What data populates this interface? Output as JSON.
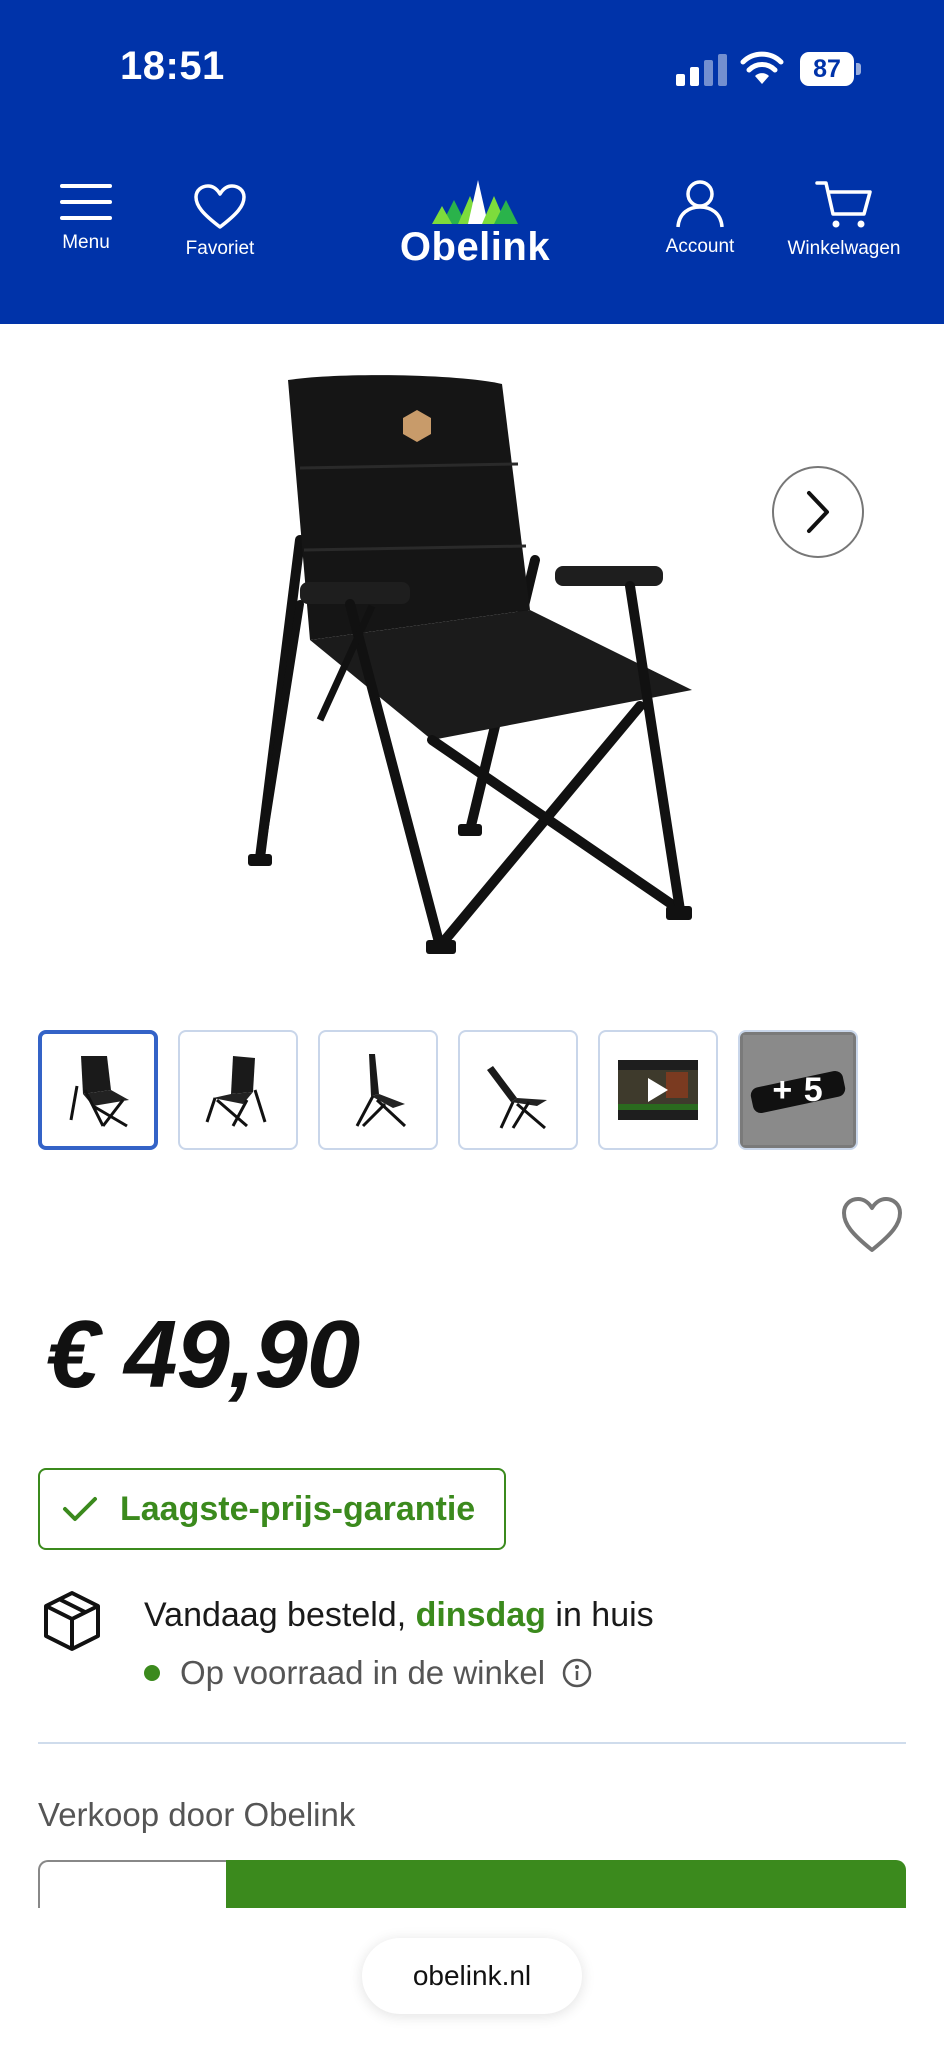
{
  "status_bar": {
    "time": "18:51",
    "battery": "87"
  },
  "nav": {
    "menu_label": "Menu",
    "favorite_label": "Favoriet",
    "logo_text": "Obelink",
    "account_label": "Account",
    "cart_label": "Winkelwagen"
  },
  "colors": {
    "brand_blue": "#0033a9",
    "accent_green": "#3b8a1d",
    "thumb_active": "#3463c7"
  },
  "gallery": {
    "thumbnails": [
      {
        "kind": "image",
        "active": true
      },
      {
        "kind": "image",
        "active": false
      },
      {
        "kind": "image",
        "active": false
      },
      {
        "kind": "image",
        "active": false
      },
      {
        "kind": "video",
        "active": false
      },
      {
        "kind": "more",
        "label": "+ 5"
      }
    ]
  },
  "product": {
    "price": "€ 49,90",
    "guarantee_label": "Laagste-prijs-garantie",
    "delivery_prefix": "Vandaag besteld, ",
    "delivery_day": "dinsdag",
    "delivery_suffix": " in huis",
    "stock_text": "Op voorraad in de winkel",
    "seller_text": "Verkoop door Obelink"
  },
  "browser": {
    "url": "obelink.nl"
  }
}
